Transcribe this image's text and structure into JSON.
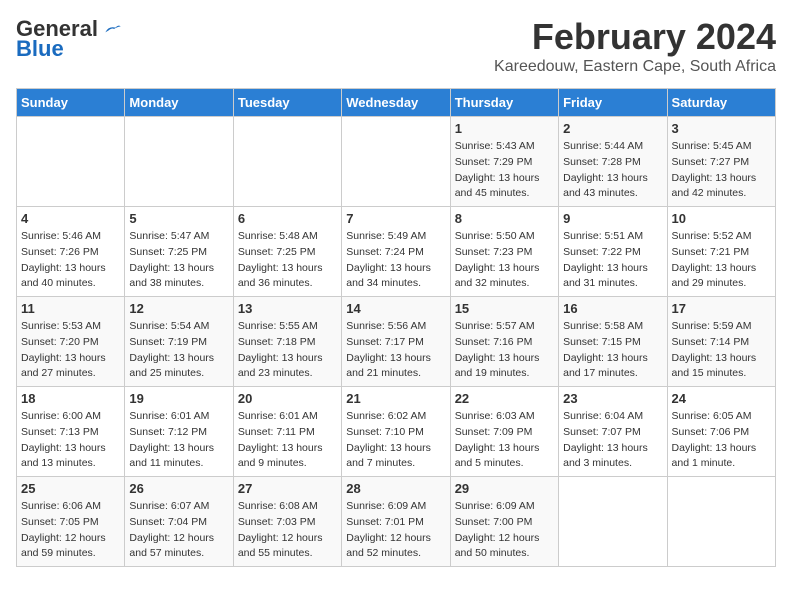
{
  "logo": {
    "general": "General",
    "blue": "Blue"
  },
  "title": "February 2024",
  "location": "Kareedouw, Eastern Cape, South Africa",
  "days_of_week": [
    "Sunday",
    "Monday",
    "Tuesday",
    "Wednesday",
    "Thursday",
    "Friday",
    "Saturday"
  ],
  "weeks": [
    [
      {
        "day": "",
        "info": ""
      },
      {
        "day": "",
        "info": ""
      },
      {
        "day": "",
        "info": ""
      },
      {
        "day": "",
        "info": ""
      },
      {
        "day": "1",
        "info": "Sunrise: 5:43 AM\nSunset: 7:29 PM\nDaylight: 13 hours\nand 45 minutes."
      },
      {
        "day": "2",
        "info": "Sunrise: 5:44 AM\nSunset: 7:28 PM\nDaylight: 13 hours\nand 43 minutes."
      },
      {
        "day": "3",
        "info": "Sunrise: 5:45 AM\nSunset: 7:27 PM\nDaylight: 13 hours\nand 42 minutes."
      }
    ],
    [
      {
        "day": "4",
        "info": "Sunrise: 5:46 AM\nSunset: 7:26 PM\nDaylight: 13 hours\nand 40 minutes."
      },
      {
        "day": "5",
        "info": "Sunrise: 5:47 AM\nSunset: 7:25 PM\nDaylight: 13 hours\nand 38 minutes."
      },
      {
        "day": "6",
        "info": "Sunrise: 5:48 AM\nSunset: 7:25 PM\nDaylight: 13 hours\nand 36 minutes."
      },
      {
        "day": "7",
        "info": "Sunrise: 5:49 AM\nSunset: 7:24 PM\nDaylight: 13 hours\nand 34 minutes."
      },
      {
        "day": "8",
        "info": "Sunrise: 5:50 AM\nSunset: 7:23 PM\nDaylight: 13 hours\nand 32 minutes."
      },
      {
        "day": "9",
        "info": "Sunrise: 5:51 AM\nSunset: 7:22 PM\nDaylight: 13 hours\nand 31 minutes."
      },
      {
        "day": "10",
        "info": "Sunrise: 5:52 AM\nSunset: 7:21 PM\nDaylight: 13 hours\nand 29 minutes."
      }
    ],
    [
      {
        "day": "11",
        "info": "Sunrise: 5:53 AM\nSunset: 7:20 PM\nDaylight: 13 hours\nand 27 minutes."
      },
      {
        "day": "12",
        "info": "Sunrise: 5:54 AM\nSunset: 7:19 PM\nDaylight: 13 hours\nand 25 minutes."
      },
      {
        "day": "13",
        "info": "Sunrise: 5:55 AM\nSunset: 7:18 PM\nDaylight: 13 hours\nand 23 minutes."
      },
      {
        "day": "14",
        "info": "Sunrise: 5:56 AM\nSunset: 7:17 PM\nDaylight: 13 hours\nand 21 minutes."
      },
      {
        "day": "15",
        "info": "Sunrise: 5:57 AM\nSunset: 7:16 PM\nDaylight: 13 hours\nand 19 minutes."
      },
      {
        "day": "16",
        "info": "Sunrise: 5:58 AM\nSunset: 7:15 PM\nDaylight: 13 hours\nand 17 minutes."
      },
      {
        "day": "17",
        "info": "Sunrise: 5:59 AM\nSunset: 7:14 PM\nDaylight: 13 hours\nand 15 minutes."
      }
    ],
    [
      {
        "day": "18",
        "info": "Sunrise: 6:00 AM\nSunset: 7:13 PM\nDaylight: 13 hours\nand 13 minutes."
      },
      {
        "day": "19",
        "info": "Sunrise: 6:01 AM\nSunset: 7:12 PM\nDaylight: 13 hours\nand 11 minutes."
      },
      {
        "day": "20",
        "info": "Sunrise: 6:01 AM\nSunset: 7:11 PM\nDaylight: 13 hours\nand 9 minutes."
      },
      {
        "day": "21",
        "info": "Sunrise: 6:02 AM\nSunset: 7:10 PM\nDaylight: 13 hours\nand 7 minutes."
      },
      {
        "day": "22",
        "info": "Sunrise: 6:03 AM\nSunset: 7:09 PM\nDaylight: 13 hours\nand 5 minutes."
      },
      {
        "day": "23",
        "info": "Sunrise: 6:04 AM\nSunset: 7:07 PM\nDaylight: 13 hours\nand 3 minutes."
      },
      {
        "day": "24",
        "info": "Sunrise: 6:05 AM\nSunset: 7:06 PM\nDaylight: 13 hours\nand 1 minute."
      }
    ],
    [
      {
        "day": "25",
        "info": "Sunrise: 6:06 AM\nSunset: 7:05 PM\nDaylight: 12 hours\nand 59 minutes."
      },
      {
        "day": "26",
        "info": "Sunrise: 6:07 AM\nSunset: 7:04 PM\nDaylight: 12 hours\nand 57 minutes."
      },
      {
        "day": "27",
        "info": "Sunrise: 6:08 AM\nSunset: 7:03 PM\nDaylight: 12 hours\nand 55 minutes."
      },
      {
        "day": "28",
        "info": "Sunrise: 6:09 AM\nSunset: 7:01 PM\nDaylight: 12 hours\nand 52 minutes."
      },
      {
        "day": "29",
        "info": "Sunrise: 6:09 AM\nSunset: 7:00 PM\nDaylight: 12 hours\nand 50 minutes."
      },
      {
        "day": "",
        "info": ""
      },
      {
        "day": "",
        "info": ""
      }
    ]
  ]
}
